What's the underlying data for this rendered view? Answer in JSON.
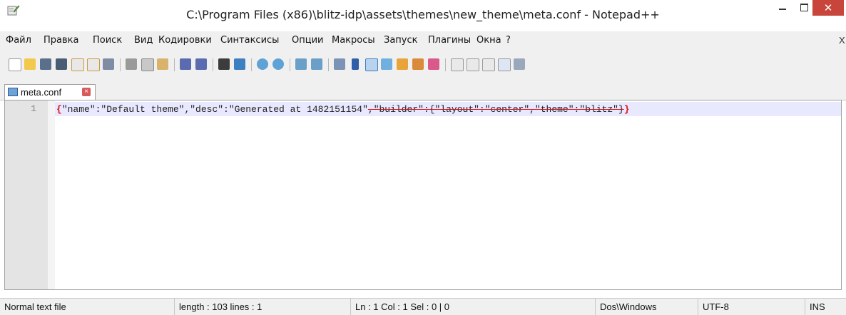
{
  "window": {
    "title": "C:\\Program Files (x86)\\blitz-idp\\assets\\themes\\new_theme\\meta.conf - Notepad++",
    "close_glyph": "✕"
  },
  "menu": [
    "Файл",
    "Правка",
    "Поиск",
    "Вид",
    "Кодировки",
    "Синтаксисы",
    "Опции",
    "Макросы",
    "Запуск",
    "Плагины",
    "Окна",
    "?"
  ],
  "menu_close": "X",
  "toolbar": {
    "icons": [
      "new-file-icon",
      "open-file-icon",
      "save-icon",
      "save-all-icon",
      "close-icon",
      "close-all-icon",
      "print-icon",
      "cut-icon",
      "copy-icon",
      "paste-icon",
      "undo-icon",
      "redo-icon",
      "find-icon",
      "replace-icon",
      "zoom-in-icon",
      "zoom-out-icon",
      "sync-v-icon",
      "sync-h-icon",
      "wrap-icon",
      "show-all-chars-icon",
      "indent-guide-icon",
      "doc-map-icon",
      "function-list-icon",
      "folder-icon",
      "monitoring-icon",
      "record-macro-icon",
      "stop-macro-icon",
      "play-macro-icon",
      "run-macro-multiple-icon",
      "save-macro-icon"
    ]
  },
  "tab": {
    "label": "meta.conf",
    "close_glyph": "×"
  },
  "editor": {
    "line_number": "1",
    "code": {
      "brace_open": "{",
      "part1": "\"name\":\"Default theme\",\"desc\":\"Generated at 1482151154\"",
      "part2": ",\"builder\":{\"layout\":\"center\",\"theme\":\"blitz\"}",
      "brace_close": "}"
    }
  },
  "status": {
    "file_type": "Normal text file",
    "length_lines": "length : 103    lines : 1",
    "position": "Ln : 1    Col : 1    Sel : 0 | 0",
    "eol": "Dos\\Windows",
    "encoding": "UTF-8",
    "mode": "INS"
  },
  "colors": {
    "close_button": "#c7453a",
    "brace": "#e01010",
    "current_line": "#e8e8ff"
  }
}
